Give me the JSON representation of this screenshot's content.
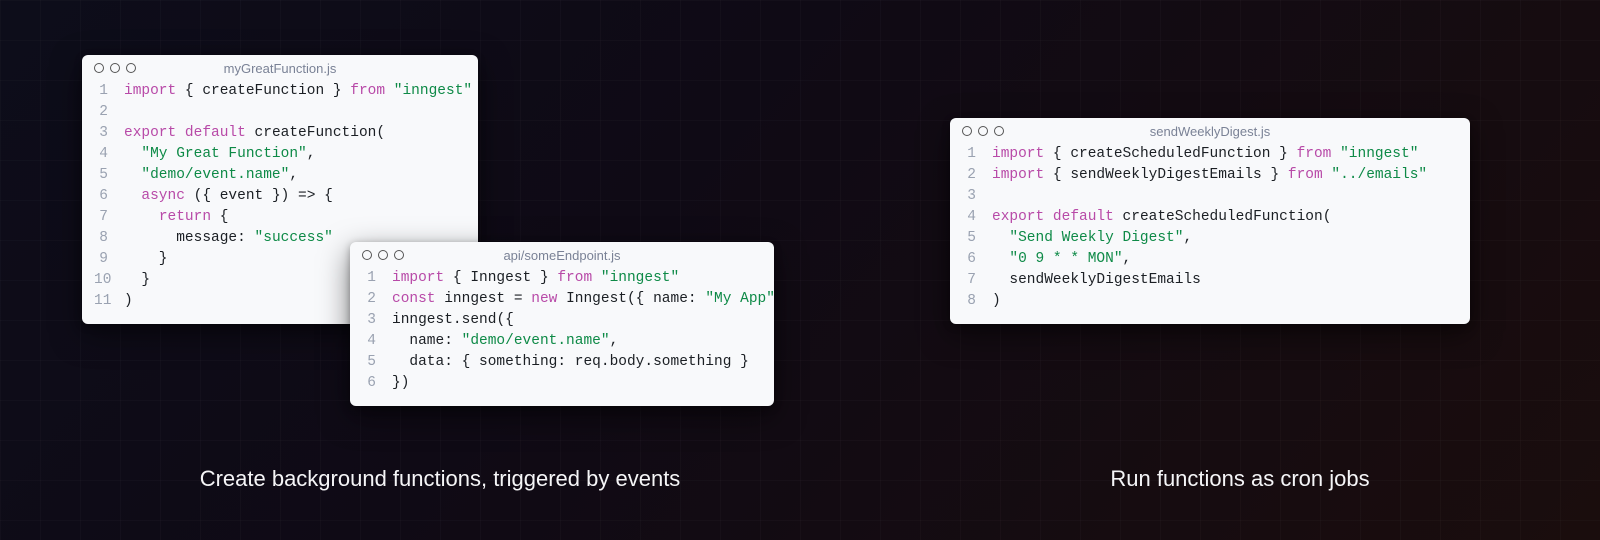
{
  "cards": {
    "func": {
      "title": "myGreatFunction.js",
      "lines": [
        [
          [
            "kw",
            "import"
          ],
          [
            "punc",
            " { "
          ],
          [
            "arg",
            "createFunction"
          ],
          [
            "punc",
            " } "
          ],
          [
            "kw",
            "from"
          ],
          [
            "punc",
            " "
          ],
          [
            "str",
            "\"inngest\""
          ]
        ],
        [],
        [
          [
            "kw",
            "export"
          ],
          [
            "punc",
            " "
          ],
          [
            "kw",
            "default"
          ],
          [
            "punc",
            " "
          ],
          [
            "fn",
            "createFunction"
          ],
          [
            "punc",
            "("
          ]
        ],
        [
          [
            "punc",
            "  "
          ],
          [
            "str",
            "\"My Great Function\""
          ],
          [
            "punc",
            ","
          ]
        ],
        [
          [
            "punc",
            "  "
          ],
          [
            "str",
            "\"demo/event.name\""
          ],
          [
            "punc",
            ","
          ]
        ],
        [
          [
            "punc",
            "  "
          ],
          [
            "kw",
            "async"
          ],
          [
            "punc",
            " ({ "
          ],
          [
            "arg",
            "event"
          ],
          [
            "punc",
            " }) => {"
          ]
        ],
        [
          [
            "punc",
            "    "
          ],
          [
            "kw",
            "return"
          ],
          [
            "punc",
            " {"
          ]
        ],
        [
          [
            "punc",
            "      "
          ],
          [
            "prop",
            "message"
          ],
          [
            "punc",
            ": "
          ],
          [
            "str",
            "\"success\""
          ]
        ],
        [
          [
            "punc",
            "    }"
          ]
        ],
        [
          [
            "punc",
            "  }"
          ]
        ],
        [
          [
            "punc",
            ")"
          ]
        ]
      ]
    },
    "api": {
      "title": "api/someEndpoint.js",
      "lines": [
        [
          [
            "kw",
            "import"
          ],
          [
            "punc",
            " { "
          ],
          [
            "arg",
            "Inngest"
          ],
          [
            "punc",
            " } "
          ],
          [
            "kw",
            "from"
          ],
          [
            "punc",
            " "
          ],
          [
            "str",
            "\"inngest\""
          ]
        ],
        [
          [
            "kw",
            "const"
          ],
          [
            "punc",
            " "
          ],
          [
            "arg",
            "inngest"
          ],
          [
            "punc",
            " = "
          ],
          [
            "kw",
            "new"
          ],
          [
            "punc",
            " "
          ],
          [
            "fn",
            "Inngest"
          ],
          [
            "punc",
            "({ "
          ],
          [
            "prop",
            "name"
          ],
          [
            "punc",
            ": "
          ],
          [
            "str",
            "\"My App\""
          ],
          [
            "punc",
            " })"
          ]
        ],
        [
          [
            "fn",
            "inngest"
          ],
          [
            "punc",
            "."
          ],
          [
            "fn",
            "send"
          ],
          [
            "punc",
            "({"
          ]
        ],
        [
          [
            "punc",
            "  "
          ],
          [
            "prop",
            "name"
          ],
          [
            "punc",
            ": "
          ],
          [
            "str",
            "\"demo/event.name\""
          ],
          [
            "punc",
            ","
          ]
        ],
        [
          [
            "punc",
            "  "
          ],
          [
            "prop",
            "data"
          ],
          [
            "punc",
            ": { "
          ],
          [
            "prop",
            "something"
          ],
          [
            "punc",
            ": "
          ],
          [
            "fn",
            "req"
          ],
          [
            "punc",
            "."
          ],
          [
            "fn",
            "body"
          ],
          [
            "punc",
            "."
          ],
          [
            "fn",
            "something"
          ],
          [
            "punc",
            " }"
          ]
        ],
        [
          [
            "punc",
            "})"
          ]
        ]
      ]
    },
    "sched": {
      "title": "sendWeeklyDigest.js",
      "lines": [
        [
          [
            "kw",
            "import"
          ],
          [
            "punc",
            " { "
          ],
          [
            "arg",
            "createScheduledFunction"
          ],
          [
            "punc",
            " } "
          ],
          [
            "kw",
            "from"
          ],
          [
            "punc",
            " "
          ],
          [
            "str",
            "\"inngest\""
          ]
        ],
        [
          [
            "kw",
            "import"
          ],
          [
            "punc",
            " { "
          ],
          [
            "arg",
            "sendWeeklyDigestEmails"
          ],
          [
            "punc",
            " } "
          ],
          [
            "kw",
            "from"
          ],
          [
            "punc",
            " "
          ],
          [
            "str",
            "\"../emails\""
          ]
        ],
        [],
        [
          [
            "kw",
            "export"
          ],
          [
            "punc",
            " "
          ],
          [
            "kw",
            "default"
          ],
          [
            "punc",
            " "
          ],
          [
            "fn",
            "createScheduledFunction"
          ],
          [
            "punc",
            "("
          ]
        ],
        [
          [
            "punc",
            "  "
          ],
          [
            "str",
            "\"Send Weekly Digest\""
          ],
          [
            "punc",
            ","
          ]
        ],
        [
          [
            "punc",
            "  "
          ],
          [
            "str",
            "\"0 9 * * MON\""
          ],
          [
            "punc",
            ","
          ]
        ],
        [
          [
            "punc",
            "  "
          ],
          [
            "fn",
            "sendWeeklyDigestEmails"
          ]
        ],
        [
          [
            "punc",
            ")"
          ]
        ]
      ]
    }
  },
  "captions": {
    "left": "Create background functions, triggered by events",
    "right": "Run functions as cron jobs"
  }
}
